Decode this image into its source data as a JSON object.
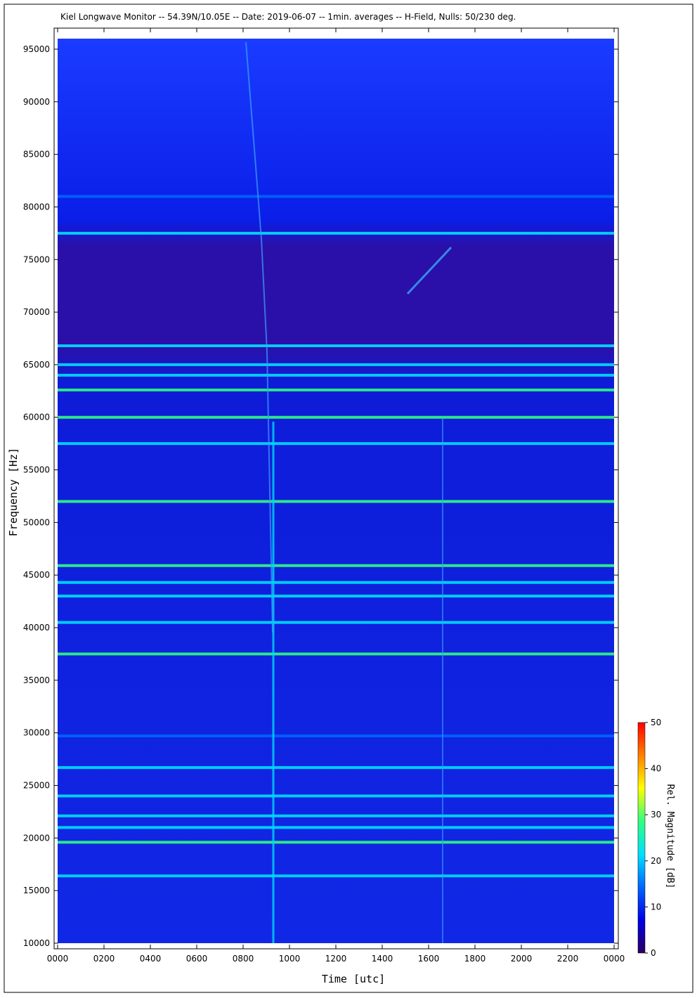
{
  "chart_data": {
    "type": "heatmap",
    "title": "Kiel Longwave Monitor -- 54.39N/10.05E -- Date: 2019-06-07 -- 1min. averages -- H-Field, Nulls: 50/230 deg.",
    "xlabel": "Time [utc]",
    "ylabel": "Frequency [Hz]",
    "xlim": [
      0,
      2400
    ],
    "ylim": [
      10000,
      96000
    ],
    "x_ticks": [
      "0000",
      "0200",
      "0400",
      "0600",
      "0800",
      "1000",
      "1200",
      "1400",
      "1600",
      "1800",
      "2000",
      "2200",
      "0000"
    ],
    "y_ticks": [
      "10000",
      "15000",
      "20000",
      "25000",
      "30000",
      "35000",
      "40000",
      "45000",
      "50000",
      "55000",
      "60000",
      "65000",
      "70000",
      "75000",
      "80000",
      "85000",
      "90000",
      "95000"
    ],
    "colorbar": {
      "label": "Rel. Magnitude [dB]",
      "range": [
        0,
        50
      ],
      "ticks": [
        "0",
        "10",
        "20",
        "30",
        "40",
        "50"
      ],
      "colors": [
        "#2a0060",
        "#0000e6",
        "#0066ff",
        "#00e0ff",
        "#30ff80",
        "#ffff00",
        "#ff8000",
        "#ff0000"
      ]
    },
    "background_db": 9,
    "bands": [
      {
        "freq": 81000,
        "db": 17
      },
      {
        "freq": 77500,
        "db": 24
      },
      {
        "freq": 66800,
        "db": 20
      },
      {
        "freq": 65000,
        "db": 22
      },
      {
        "freq": 64000,
        "db": 19
      },
      {
        "freq": 62600,
        "db": 26
      },
      {
        "freq": 60000,
        "db": 27
      },
      {
        "freq": 57500,
        "db": 23
      },
      {
        "freq": 52000,
        "db": 25
      },
      {
        "freq": 45900,
        "db": 28
      },
      {
        "freq": 44300,
        "db": 20
      },
      {
        "freq": 43000,
        "db": 18
      },
      {
        "freq": 40500,
        "db": 20
      },
      {
        "freq": 37500,
        "db": 28
      },
      {
        "freq": 29700,
        "db": 17
      },
      {
        "freq": 26700,
        "db": 18
      },
      {
        "freq": 24000,
        "db": 19
      },
      {
        "freq": 22100,
        "db": 24
      },
      {
        "freq": 21000,
        "db": 21
      },
      {
        "freq": 19600,
        "db": 26
      },
      {
        "freq": 16400,
        "db": 19
      }
    ]
  }
}
